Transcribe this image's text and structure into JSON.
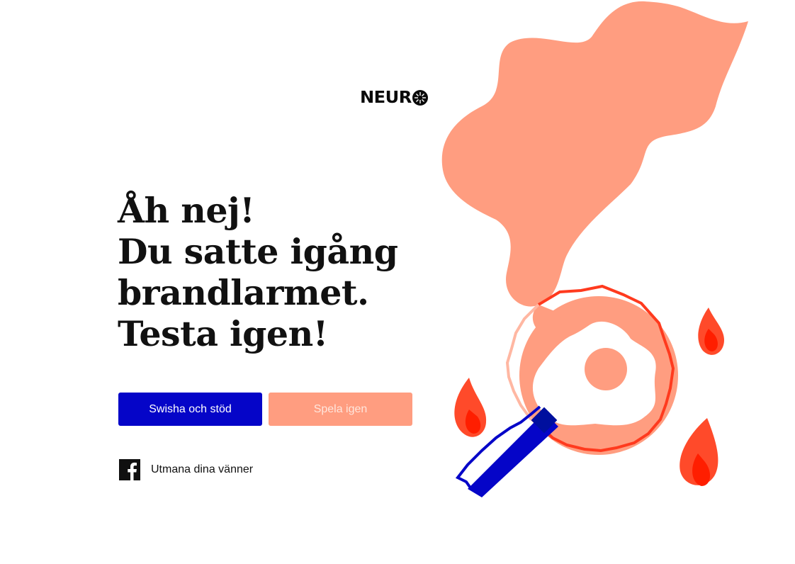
{
  "brand": {
    "logo_text": "NEUR"
  },
  "headline": {
    "lines": [
      "Åh nej!",
      "Du satte igång",
      "brandlarmet.",
      "Testa igen!"
    ]
  },
  "actions": {
    "swish_label": "Swisha och stöd",
    "replay_label": "Spela igen"
  },
  "share": {
    "label": "Utmana dina vänner",
    "icon": "facebook-icon"
  },
  "colors": {
    "primary": "#0505c8",
    "accent": "#ff9d80",
    "flame": "#ff3a1e",
    "text": "#111111"
  }
}
